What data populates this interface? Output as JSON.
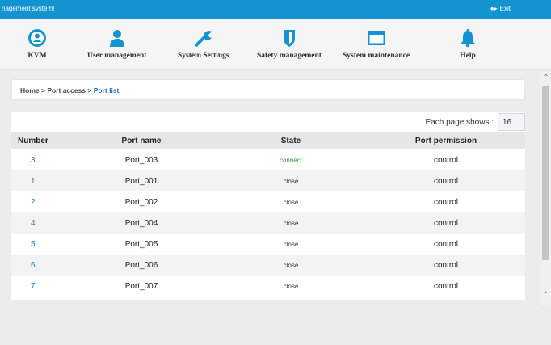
{
  "topbar": {
    "title": "nagement system!",
    "exit_label": "Exit",
    "color": "#1493d1"
  },
  "nav": [
    {
      "label": "KVM",
      "icon": "kvm-icon"
    },
    {
      "label": "User management",
      "icon": "user-icon"
    },
    {
      "label": "System Settings",
      "icon": "wrench-icon"
    },
    {
      "label": "Safety management",
      "icon": "shield-icon"
    },
    {
      "label": "System maintenance",
      "icon": "window-icon"
    },
    {
      "label": "Help",
      "icon": "bell-icon"
    }
  ],
  "breadcrumb": {
    "home": "Home",
    "sep1": " > ",
    "section": "Port access",
    "sep2": " > ",
    "current": "Port list"
  },
  "pager": {
    "label": "Each page shows :",
    "value": "16"
  },
  "table": {
    "headers": [
      "Number",
      "Port name",
      "State",
      "Port permission"
    ],
    "rows": [
      {
        "number": "3",
        "name": "Port_003",
        "state": "connect",
        "permission": "control"
      },
      {
        "number": "1",
        "name": "Port_001",
        "state": "close",
        "permission": "control"
      },
      {
        "number": "2",
        "name": "Port_002",
        "state": "close",
        "permission": "control"
      },
      {
        "number": "4",
        "name": "Port_004",
        "state": "close",
        "permission": "control"
      },
      {
        "number": "5",
        "name": "Port_005",
        "state": "close",
        "permission": "control"
      },
      {
        "number": "6",
        "name": "Port_006",
        "state": "close",
        "permission": "control"
      },
      {
        "number": "7",
        "name": "Port_007",
        "state": "close",
        "permission": "control"
      }
    ]
  },
  "colors": {
    "accent": "#1493d1",
    "link": "#2a76c0",
    "connect": "#3a9a3a"
  }
}
